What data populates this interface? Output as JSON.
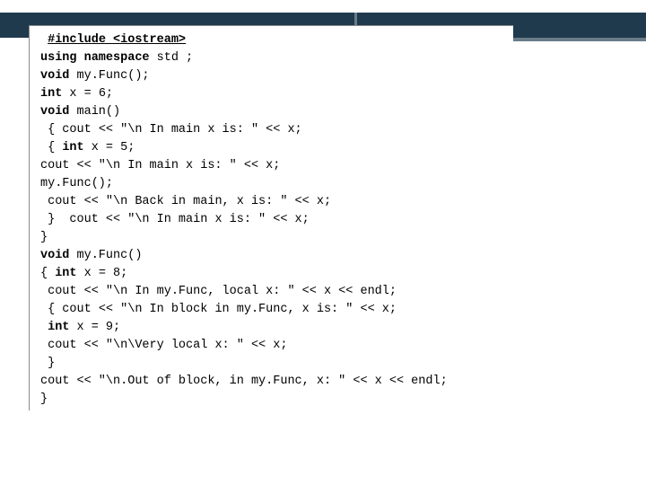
{
  "code": {
    "lines": [
      {
        "lead": " ",
        "segments": [
          {
            "t": "#include <iostream>",
            "cls": "directive"
          }
        ]
      },
      {
        "lead": "",
        "segments": [
          {
            "t": "using namespace",
            "cls": "kw"
          },
          {
            "t": " std ;"
          }
        ]
      },
      {
        "lead": "",
        "segments": [
          {
            "t": "void",
            "cls": "kw"
          },
          {
            "t": " my.Func();"
          }
        ]
      },
      {
        "lead": "",
        "segments": [
          {
            "t": "int",
            "cls": "kw"
          },
          {
            "t": " x = 6;"
          }
        ]
      },
      {
        "lead": "",
        "segments": [
          {
            "t": "void",
            "cls": "kw"
          },
          {
            "t": " main()"
          }
        ]
      },
      {
        "lead": " ",
        "segments": [
          {
            "t": "{ cout << \"\\n In main x is: \" << x;"
          }
        ]
      },
      {
        "lead": " ",
        "segments": [
          {
            "t": "{ "
          },
          {
            "t": "int",
            "cls": "kw"
          },
          {
            "t": " x = 5;"
          }
        ]
      },
      {
        "lead": "",
        "segments": [
          {
            "t": "cout << \"\\n In main x is: \" << x;"
          }
        ]
      },
      {
        "lead": "",
        "segments": [
          {
            "t": "my.Func();"
          }
        ]
      },
      {
        "lead": " ",
        "segments": [
          {
            "t": "cout << \"\\n Back in main, x is: \" << x;"
          }
        ]
      },
      {
        "lead": " ",
        "segments": [
          {
            "t": "}  cout << \"\\n In main x is: \" << x;"
          }
        ]
      },
      {
        "lead": "",
        "segments": [
          {
            "t": "}"
          }
        ]
      },
      {
        "lead": "",
        "segments": [
          {
            "t": "void",
            "cls": "kw"
          },
          {
            "t": " my.Func()"
          }
        ]
      },
      {
        "lead": "",
        "segments": [
          {
            "t": "{ "
          },
          {
            "t": "int",
            "cls": "kw"
          },
          {
            "t": " x = 8;"
          }
        ]
      },
      {
        "lead": " ",
        "segments": [
          {
            "t": "cout << \"\\n In my.Func, local x: \" << x << endl;"
          }
        ]
      },
      {
        "lead": " ",
        "segments": [
          {
            "t": "{ cout << \"\\n In block in my.Func, x is: \" << x;"
          }
        ]
      },
      {
        "lead": " ",
        "segments": [
          {
            "t": "int",
            "cls": "kw"
          },
          {
            "t": " x = 9;"
          }
        ]
      },
      {
        "lead": " ",
        "segments": [
          {
            "t": "cout << \"\\n\\Very local x: \" << x;"
          }
        ]
      },
      {
        "lead": " ",
        "segments": [
          {
            "t": "}"
          }
        ]
      },
      {
        "lead": "",
        "segments": [
          {
            "t": "cout << \"\\n.Out of block, in my.Func, x: \" << x << endl;"
          }
        ]
      },
      {
        "lead": "",
        "segments": [
          {
            "t": "}"
          }
        ]
      }
    ]
  }
}
